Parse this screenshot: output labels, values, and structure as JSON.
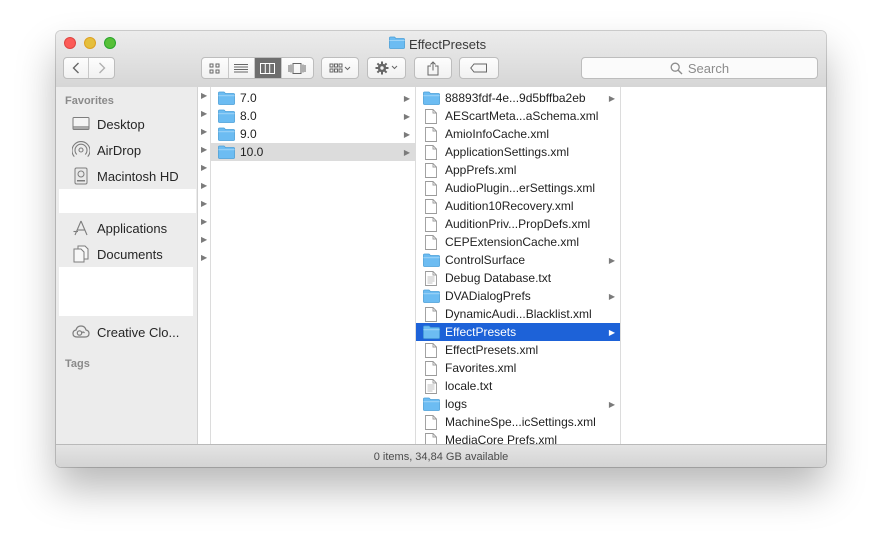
{
  "window": {
    "title": "EffectPresets"
  },
  "toolbar": {
    "search_placeholder": "Search"
  },
  "sidebar": {
    "favorites_header": "Favorites",
    "tags_header": "Tags",
    "items": [
      {
        "label": "Desktop",
        "icon": "desktop-icon"
      },
      {
        "label": "AirDrop",
        "icon": "airdrop-icon"
      },
      {
        "label": "Macintosh HD",
        "icon": "harddrive-icon"
      },
      {
        "label": "Applications",
        "icon": "applications-icon"
      },
      {
        "label": "Documents",
        "icon": "documents-icon"
      },
      {
        "label": "Creative Clo...",
        "icon": "creative-cloud-icon"
      }
    ]
  },
  "column1": {
    "items": [
      {
        "label": "7.0",
        "kind": "folder"
      },
      {
        "label": "8.0",
        "kind": "folder"
      },
      {
        "label": "9.0",
        "kind": "folder"
      },
      {
        "label": "10.0",
        "kind": "folder",
        "selected": true
      }
    ]
  },
  "column2": {
    "items": [
      {
        "label": "88893fdf-4e...9d5bffba2eb",
        "kind": "folder"
      },
      {
        "label": "AEScartMeta...aSchema.xml",
        "kind": "file"
      },
      {
        "label": "AmioInfoCache.xml",
        "kind": "file"
      },
      {
        "label": "ApplicationSettings.xml",
        "kind": "file"
      },
      {
        "label": "AppPrefs.xml",
        "kind": "file"
      },
      {
        "label": "AudioPlugin...erSettings.xml",
        "kind": "file"
      },
      {
        "label": "Audition10Recovery.xml",
        "kind": "file"
      },
      {
        "label": "AuditionPriv...PropDefs.xml",
        "kind": "file"
      },
      {
        "label": "CEPExtensionCache.xml",
        "kind": "file"
      },
      {
        "label": "ControlSurface",
        "kind": "folder"
      },
      {
        "label": "Debug Database.txt",
        "kind": "text"
      },
      {
        "label": "DVADialogPrefs",
        "kind": "folder"
      },
      {
        "label": "DynamicAudi...Blacklist.xml",
        "kind": "file"
      },
      {
        "label": "EffectPresets",
        "kind": "folder",
        "selected": true
      },
      {
        "label": "EffectPresets.xml",
        "kind": "file"
      },
      {
        "label": "Favorites.xml",
        "kind": "file"
      },
      {
        "label": "locale.txt",
        "kind": "text"
      },
      {
        "label": "logs",
        "kind": "folder"
      },
      {
        "label": "MachineSpe...icSettings.xml",
        "kind": "file"
      },
      {
        "label": "MediaCore Prefs.xml",
        "kind": "file"
      }
    ]
  },
  "statusbar": {
    "text": "0 items, 34,84 GB available"
  },
  "colors": {
    "selection_blue": "#1d62d8",
    "folder_blue": "#6cbcf2",
    "close_red": "#fc5b57",
    "minimize_yellow": "#e5bf3c",
    "zoom_green": "#57c038"
  }
}
